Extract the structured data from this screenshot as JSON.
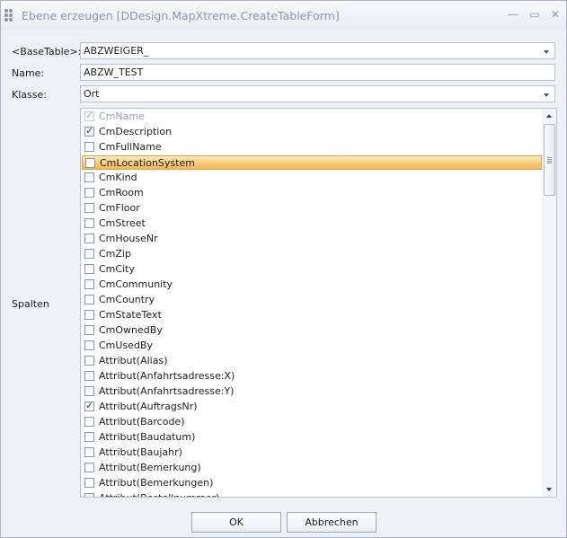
{
  "window": {
    "title": "Ebene erzeugen [DDesign.MapXtreme.CreateTableForm]",
    "minimize_icon": "—",
    "maximize_icon": "▭",
    "close_icon": "✕"
  },
  "form": {
    "basetable_label": "<BaseTable>:",
    "basetable_value": "ABZWEIGER_",
    "name_label": "Name:",
    "name_value": "ABZW_TEST",
    "klasse_label": "Klasse:",
    "klasse_value": "Ort",
    "spalten_label": "Spalten"
  },
  "columns": [
    {
      "label": "CmName",
      "checked": true,
      "disabled": true
    },
    {
      "label": "CmDescription",
      "checked": true
    },
    {
      "label": "CmFullName",
      "checked": false
    },
    {
      "label": "CmLocationSystem",
      "checked": false,
      "selected": true
    },
    {
      "label": "CmKind",
      "checked": false
    },
    {
      "label": "CmRoom",
      "checked": false
    },
    {
      "label": "CmFloor",
      "checked": false
    },
    {
      "label": "CmStreet",
      "checked": false
    },
    {
      "label": "CmHouseNr",
      "checked": false
    },
    {
      "label": "CmZip",
      "checked": false
    },
    {
      "label": "CmCity",
      "checked": false
    },
    {
      "label": "CmCommunity",
      "checked": false
    },
    {
      "label": "CmCountry",
      "checked": false
    },
    {
      "label": "CmStateText",
      "checked": false
    },
    {
      "label": "CmOwnedBy",
      "checked": false
    },
    {
      "label": "CmUsedBy",
      "checked": false
    },
    {
      "label": "Attribut(Alias)",
      "checked": false
    },
    {
      "label": "Attribut(Anfahrtsadresse:X)",
      "checked": false
    },
    {
      "label": "Attribut(Anfahrtsadresse:Y)",
      "checked": false
    },
    {
      "label": "Attribut(AuftragsNr)",
      "checked": true
    },
    {
      "label": "Attribut(Barcode)",
      "checked": false
    },
    {
      "label": "Attribut(Baudatum)",
      "checked": false
    },
    {
      "label": "Attribut(Baujahr)",
      "checked": false
    },
    {
      "label": "Attribut(Bemerkung)",
      "checked": false
    },
    {
      "label": "Attribut(Bemerkungen)",
      "checked": false
    },
    {
      "label": "Attribut(Bestellnummer)",
      "checked": false
    }
  ],
  "buttons": {
    "ok": "OK",
    "cancel": "Abbrechen"
  },
  "colors": {
    "selection": "#f7c978",
    "window_bg": "#eef0f5"
  }
}
